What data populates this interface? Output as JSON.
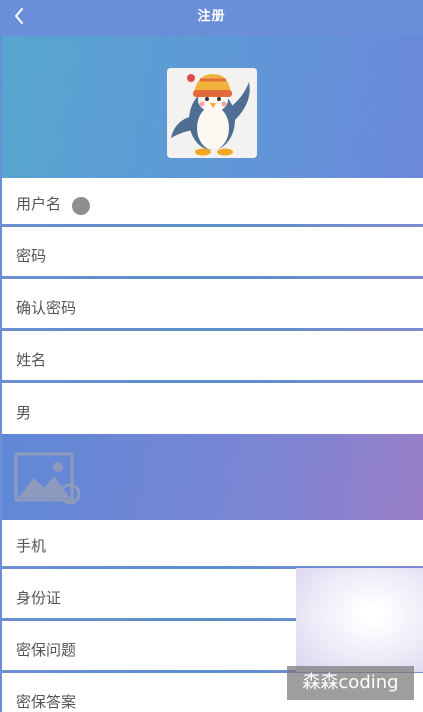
{
  "header": {
    "title": "注册",
    "back_icon": "chevron-left-icon"
  },
  "avatar": {
    "icon": "penguin-avatar-icon"
  },
  "form": {
    "username_label": "用户名",
    "password_label": "密码",
    "confirm_password_label": "确认密码",
    "name_label": "姓名",
    "gender_value": "男",
    "phone_label": "手机",
    "id_card_label": "身份证",
    "security_question_label": "密保问题",
    "security_answer_label": "密保答案"
  },
  "photo_placeholder": {
    "icon": "image-placeholder-icon"
  },
  "watermark": {
    "text": "森森coding"
  },
  "colors": {
    "header_bg": "#6b8ed9",
    "hero_gradient_start": "#57a6cf",
    "hero_gradient_end": "#6b88da",
    "photo_gradient_end": "#9a7fc8"
  }
}
